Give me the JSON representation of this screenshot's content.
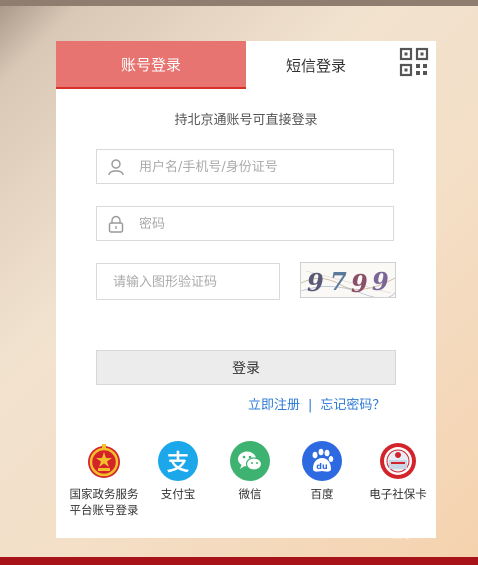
{
  "tabs": {
    "account_label": "账号登录",
    "sms_label": "短信登录"
  },
  "subtitle": "持北京通账号可直接登录",
  "fields": {
    "username_placeholder": "用户名/手机号/身份证号",
    "password_placeholder": "密码",
    "captcha_placeholder": "请输入图形验证码"
  },
  "captcha_text": "9799",
  "login_label": "登录",
  "links": {
    "register": "立即注册",
    "separator": "|",
    "forgot": "忘记密码？"
  },
  "social": [
    {
      "label_line1": "国家政务服务",
      "label_line2": "平台账号登录",
      "icon": "national-emblem-icon",
      "color": "#c9161d"
    },
    {
      "label_line1": "支付宝",
      "icon": "alipay-icon",
      "color": "#1ba7ea"
    },
    {
      "label_line1": "微信",
      "icon": "wechat-icon",
      "color": "#3eb371"
    },
    {
      "label_line1": "百度",
      "icon": "baidu-icon",
      "color": "#2d69e0"
    },
    {
      "label_line1": "电子社保卡",
      "icon": "social-security-card-icon",
      "color": "#d3242c"
    }
  ],
  "watermark": "Bai经验"
}
